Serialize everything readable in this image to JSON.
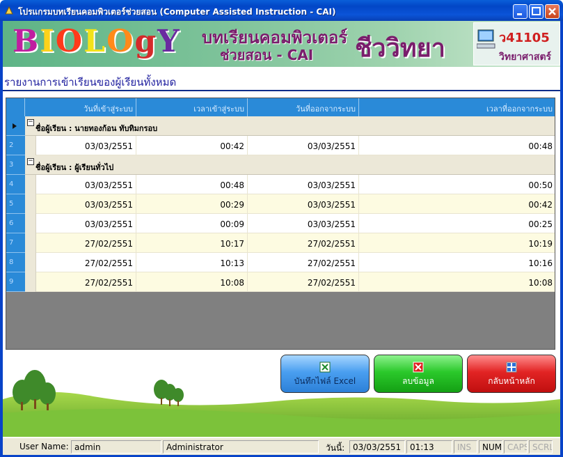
{
  "window": {
    "title": "โปรแกรมบทเรียนคอมพิวเตอร์ช่วยสอน (Computer Assisted Instruction - CAI)"
  },
  "banner": {
    "logo_letters": [
      "B",
      "I",
      "O",
      "L",
      "O",
      "g",
      "Y"
    ],
    "logo_colors": [
      "#c01fa0",
      "#ffd21a",
      "#ff3a1a",
      "#f2e21a",
      "#ff8a1a",
      "#d42a2a",
      "#6a2aa0"
    ],
    "subtitle_line1": "บทเรียนคอมพิวเตอร์",
    "subtitle_line2": "ช่วยสอน - CAI",
    "big_title": "ชีววิทยา",
    "course_code": "ว41105",
    "subject": "วิทยาศาสตร์"
  },
  "report": {
    "title": "รายงานการเข้าเรียนของผู้เรียนทั้งหมด"
  },
  "grid": {
    "columns": [
      "วันที่เข้าสู่ระบบ",
      "เวลาเข้าสู่ระบบ",
      "วันที่ออกจากระบบ",
      "เวลาที่ออกจากระบบ"
    ],
    "rows": [
      {
        "kind": "group",
        "header": "",
        "label": "ชื่อผู้เรียน : นายทองก้อน ทับทิมกรอบ",
        "selected": true
      },
      {
        "kind": "data",
        "header": "2",
        "values": [
          "03/03/2551",
          "00:42",
          "03/03/2551",
          "00:48"
        ]
      },
      {
        "kind": "group",
        "header": "3",
        "label": "ชื่อผู้เรียน : ผู้เรียนทั่วไป"
      },
      {
        "kind": "data",
        "header": "4",
        "values": [
          "03/03/2551",
          "00:48",
          "03/03/2551",
          "00:50"
        ]
      },
      {
        "kind": "alt",
        "header": "5",
        "values": [
          "03/03/2551",
          "00:29",
          "03/03/2551",
          "00:42"
        ]
      },
      {
        "kind": "data",
        "header": "6",
        "values": [
          "03/03/2551",
          "00:09",
          "03/03/2551",
          "00:25"
        ]
      },
      {
        "kind": "alt",
        "header": "7",
        "values": [
          "27/02/2551",
          "10:17",
          "27/02/2551",
          "10:19"
        ]
      },
      {
        "kind": "data",
        "header": "8",
        "values": [
          "27/02/2551",
          "10:13",
          "27/02/2551",
          "10:16"
        ]
      },
      {
        "kind": "alt",
        "header": "9",
        "values": [
          "27/02/2551",
          "10:08",
          "27/02/2551",
          "10:08"
        ]
      }
    ]
  },
  "buttons": {
    "excel": "บันทึกไฟล์ Excel",
    "delete": "ลบข้อมูล",
    "home": "กลับหน้าหลัก"
  },
  "status": {
    "user_label": "User Name:",
    "user_value": "admin",
    "role": "Administrator",
    "date_label": "วันนี้:",
    "date_value": "03/03/2551",
    "time_value": "01:13",
    "ins": "INS",
    "num": "NUM",
    "caps": "CAPS",
    "scrl": "SCRL"
  },
  "colors": {
    "grid_header": "#2a8ad8",
    "alt_row": "#fdfbe1",
    "group_row": "#ece8d8",
    "title_bar": "#0246c6"
  }
}
